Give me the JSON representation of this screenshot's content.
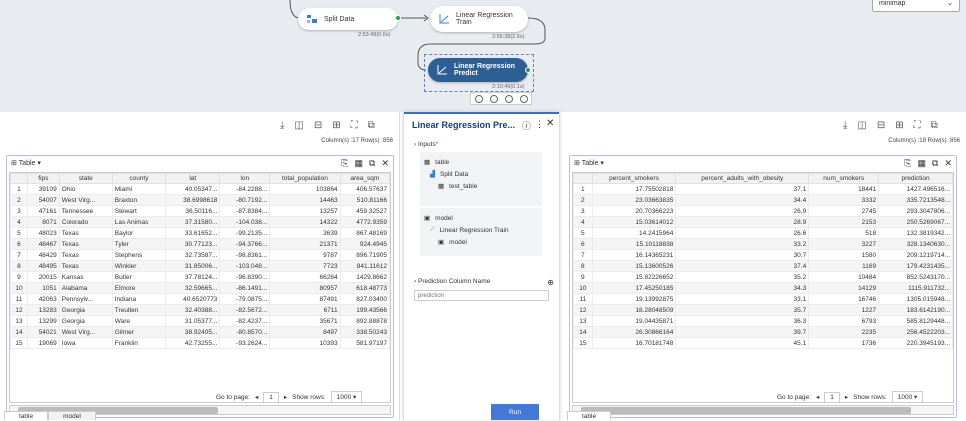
{
  "canvas": {
    "nodes": [
      {
        "label": "Split Data",
        "time": "2:53:49(0.6s)"
      },
      {
        "label": "Linear Regression Train",
        "time": "2:55:38(2.6s)"
      },
      {
        "label": "Linear Regression Predict",
        "time": "2:10:49(0.1s)"
      }
    ],
    "minimap": "minimap"
  },
  "left": {
    "status": "Column(s) :17  Row(s) :856",
    "table_label": "Table",
    "columns": [
      "",
      "fips",
      "state",
      "county",
      "lat",
      "lon",
      "total_population",
      "area_sqm"
    ],
    "rows": [
      [
        "1",
        "39109",
        "Ohio",
        "Miami",
        "40.05347...",
        "-84.2288...",
        "103864",
        "406.57637"
      ],
      [
        "2",
        "54007",
        "West Virg...",
        "Braxton",
        "38.6998618",
        "-80.7192...",
        "14463",
        "510.81166"
      ],
      [
        "3",
        "47161",
        "Tennessee",
        "Stewart",
        "36.50116...",
        "-87.8384...",
        "13257",
        "459.32527"
      ],
      [
        "4",
        "8071",
        "Colorado",
        "Las Animas",
        "37.31580...",
        "-104.038...",
        "14322",
        "4772.9359"
      ],
      [
        "5",
        "48023",
        "Texas",
        "Baylor",
        "33.61652...",
        "-99.2135...",
        "3639",
        "867.48169"
      ],
      [
        "6",
        "48467",
        "Texas",
        "Tyler",
        "30.77123...",
        "-94.3766...",
        "21371",
        "924.4945"
      ],
      [
        "7",
        "48429",
        "Texas",
        "Stephens",
        "32.73587...",
        "-98.8361...",
        "9787",
        "896.71905"
      ],
      [
        "8",
        "48495",
        "Texas",
        "Winkler",
        "31.85006...",
        "-103.048...",
        "7723",
        "841.11612"
      ],
      [
        "9",
        "20015",
        "Kansas",
        "Butler",
        "37.78124...",
        "-96.8390...",
        "66264",
        "1429.8662"
      ],
      [
        "10",
        "1051",
        "Alabama",
        "Elmore",
        "32.59665...",
        "-86.1491...",
        "80957",
        "618.48773"
      ],
      [
        "11",
        "42063",
        "Pennsylv...",
        "Indiana",
        "40.6520773",
        "-79.0875...",
        "87491",
        "827.03400"
      ],
      [
        "12",
        "13283",
        "Georgia",
        "Treutlen",
        "32.40388...",
        "-82.5672...",
        "6711",
        "199.43566"
      ],
      [
        "13",
        "13299",
        "Georgia",
        "Ware",
        "31.05377...",
        "-82.4237...",
        "35671",
        "892.88878"
      ],
      [
        "14",
        "54021",
        "West Virg...",
        "Gilmer",
        "38.92405...",
        "-80.8570...",
        "8497",
        "338.50243"
      ],
      [
        "15",
        "19069",
        "Iowa",
        "Franklin",
        "42.73255...",
        "-93.2624...",
        "10393",
        "581.97197"
      ]
    ],
    "goto_label": "Go to page:",
    "page": "1",
    "show_rows_label": "Show rows:",
    "show_rows": "1000",
    "tabs": [
      "table",
      "model"
    ]
  },
  "mid": {
    "title": "Linear Regression Pre...",
    "inputs_label": "Inputs",
    "table_group": "table",
    "table_source": "Split Data",
    "table_item": "test_table",
    "model_group": "model",
    "model_source": "Linear Regression Train",
    "model_item": "model",
    "pred_col_label": "Prediction Column Name",
    "pred_placeholder": "prediction",
    "run_label": "Run"
  },
  "right": {
    "status": "Column(s) :18  Row(s) :856",
    "table_label": "Table",
    "columns": [
      "",
      "percent_smokers",
      "percent_adults_with_obesity",
      "num_smokers",
      "prediction"
    ],
    "rows": [
      [
        "1",
        "17.75502818",
        "37.1",
        "18441",
        "1427.496516..."
      ],
      [
        "2",
        "23.03663835",
        "34.4",
        "3332",
        "335.7213548..."
      ],
      [
        "3",
        "20.70366223",
        "26.9",
        "2745",
        "293.3047806..."
      ],
      [
        "4",
        "15.03614012",
        "28.9",
        "2153",
        "250.5269067..."
      ],
      [
        "5",
        "14.2415964",
        "26.6",
        "518",
        "132.3819342..."
      ],
      [
        "6",
        "15.10118838",
        "33.2",
        "3227",
        "328.1340630..."
      ],
      [
        "7",
        "16.14365231",
        "30.7",
        "1580",
        "209.1219714..."
      ],
      [
        "8",
        "15.13600526",
        "37.4",
        "1169",
        "179.4231435..."
      ],
      [
        "9",
        "15.82226652",
        "35.2",
        "10484",
        "852.5243170..."
      ],
      [
        "10",
        "17.45250185",
        "34.3",
        "14129",
        "1115.911732..."
      ],
      [
        "11",
        "19.13992875",
        "33.1",
        "16746",
        "1305.015948..."
      ],
      [
        "12",
        "18.28048509",
        "35.7",
        "1227",
        "183.6142190..."
      ],
      [
        "13",
        "19.04435871",
        "36.3",
        "6793",
        "585.8129448..."
      ],
      [
        "14",
        "26.30866164",
        "39.7",
        "2235",
        "256.4522203..."
      ],
      [
        "15",
        "16.70181748",
        "45.1",
        "1736",
        "220.3945193..."
      ]
    ],
    "goto_label": "Go to page:",
    "page": "1",
    "show_rows_label": "Show rows:",
    "show_rows": "1000",
    "tabs": [
      "table"
    ]
  }
}
